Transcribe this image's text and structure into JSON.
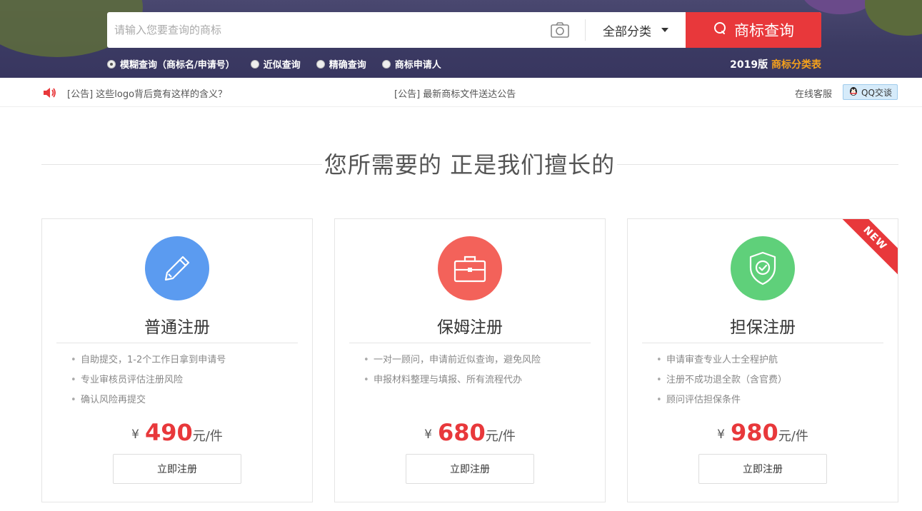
{
  "search": {
    "placeholder": "请输入您要查询的商标",
    "category": "全部分类",
    "button": "商标查询",
    "options": [
      {
        "label": "模糊查询（商标名/申请号）",
        "checked": true
      },
      {
        "label": "近似查询",
        "checked": false
      },
      {
        "label": "精确查询",
        "checked": false
      },
      {
        "label": "商标申请人",
        "checked": false
      }
    ],
    "year_prefix": "2019版",
    "year_link": "商标分类表"
  },
  "notice": {
    "item1": "[公告] 这些logo背后竟有这样的含义？",
    "item2": "[公告] 最新商标文件送达公告",
    "online": "在线客服",
    "qq": "QQ交谈"
  },
  "section": {
    "title": "您所需要的 正是我们擅长的"
  },
  "cards": [
    {
      "title": "普通注册",
      "features": [
        "自助提交，1-2个工作日拿到申请号",
        "专业审核员评估注册风险",
        "确认风险再提交"
      ],
      "currency": "¥",
      "price": "490",
      "unit": "元/件",
      "button": "立即注册",
      "color": "#5b9bf0"
    },
    {
      "title": "保姆注册",
      "features": [
        "一对一顾问，申请前近似查询，避免风险",
        "申报材料整理与填报、所有流程代办"
      ],
      "currency": "¥",
      "price": "680",
      "unit": "元/件",
      "button": "立即注册",
      "color": "#f3625a"
    },
    {
      "title": "担保注册",
      "features": [
        "申请审查专业人士全程护航",
        "注册不成功退全款（含官费）",
        "顾问评估担保条件"
      ],
      "currency": "¥",
      "price": "980",
      "unit": "元/件",
      "button": "立即注册",
      "color": "#5fd07a",
      "badge": "NEW"
    }
  ]
}
